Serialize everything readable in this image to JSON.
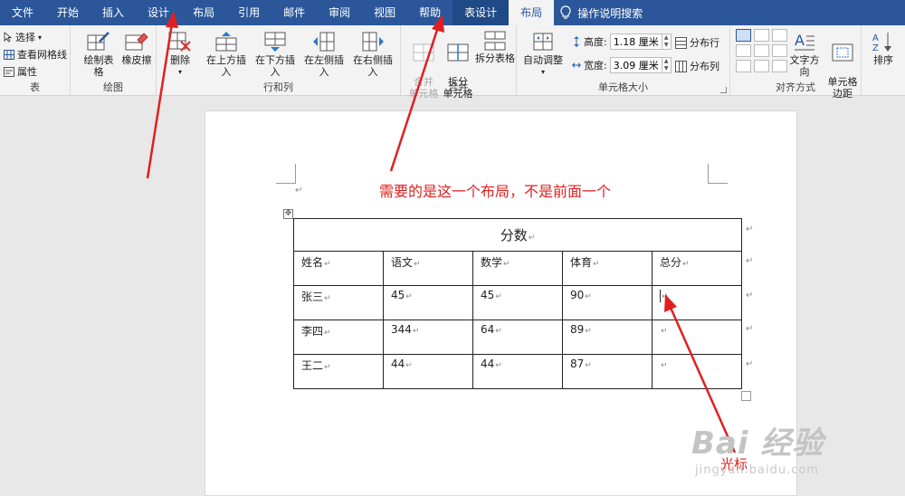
{
  "tabs": [
    {
      "label": "文件"
    },
    {
      "label": "开始"
    },
    {
      "label": "插入"
    },
    {
      "label": "设计"
    },
    {
      "label": "布局"
    },
    {
      "label": "引用"
    },
    {
      "label": "邮件"
    },
    {
      "label": "审阅"
    },
    {
      "label": "视图"
    },
    {
      "label": "帮助"
    },
    {
      "label": "表设计"
    },
    {
      "label": "布局"
    }
  ],
  "tell_me": "操作说明搜索",
  "ribbon": {
    "table_group": {
      "label": "表",
      "select": "选择",
      "gridlines": "查看网格线",
      "properties": "属性"
    },
    "draw_group": {
      "label": "绘图",
      "draw_table": "绘制表格",
      "eraser": "橡皮擦"
    },
    "rows_cols_group": {
      "label": "行和列",
      "delete": "删除",
      "insert_above": "在上方插入",
      "insert_below": "在下方插入",
      "insert_left": "在左侧插入",
      "insert_right": "在右侧插入"
    },
    "merge_group": {
      "label": "合并",
      "merge_cells": "合并\n单元格",
      "split_cells": "拆分\n单元格",
      "split_table": "拆分表格"
    },
    "cell_size_group": {
      "label": "单元格大小",
      "autofit": "自动调整",
      "height_label": "高度:",
      "height_value": "1.18 厘米",
      "width_label": "宽度:",
      "width_value": "3.09 厘米",
      "dist_rows": "分布行",
      "dist_cols": "分布列"
    },
    "align_group": {
      "label": "对齐方式",
      "text_direction": "文字方向",
      "cell_margins": "单元格\n边距"
    },
    "sort": "排序"
  },
  "annotation": "需要的是这一个布局，不是前面一个",
  "cursor_label": "光标",
  "table": {
    "title": "分数",
    "headers": [
      "姓名",
      "语文",
      "数学",
      "体育",
      "总分"
    ],
    "rows": [
      [
        "张三",
        "45",
        "45",
        "90",
        ""
      ],
      [
        "李四",
        "344",
        "64",
        "89",
        ""
      ],
      [
        "王二",
        "44",
        "44",
        "87",
        ""
      ]
    ]
  },
  "watermark": {
    "main": "Bai 经验",
    "url": "jingyan.baidu.com"
  },
  "colors": {
    "ribbon_blue": "#2b579a",
    "annotation_red": "#e02020"
  }
}
